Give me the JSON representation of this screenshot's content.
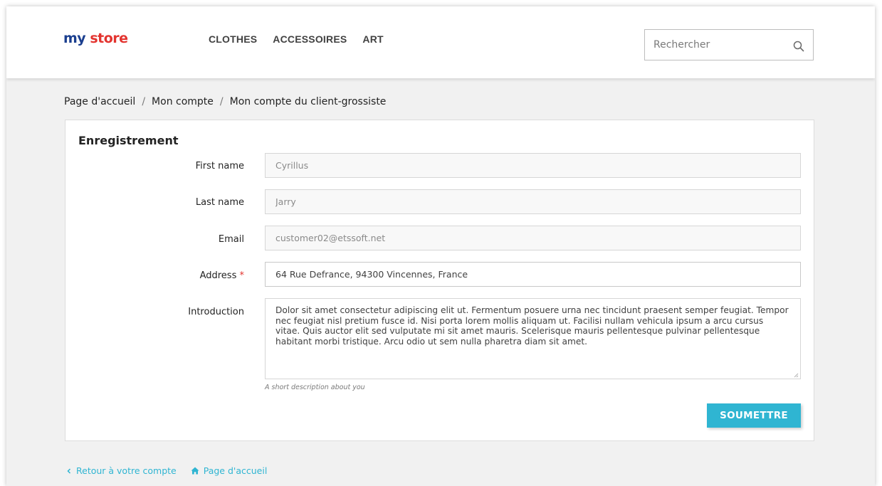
{
  "header": {
    "logo": {
      "word1": "my",
      "word2": "store"
    },
    "nav": [
      "CLOTHES",
      "ACCESSOIRES",
      "ART"
    ],
    "search": {
      "placeholder": "Rechercher",
      "icon": "search-icon"
    }
  },
  "breadcrumb": [
    "Page d'accueil",
    "Mon compte",
    "Mon compte du client-grossiste"
  ],
  "form": {
    "title": "Enregistrement",
    "fields": {
      "first_name": {
        "label": "First name",
        "value": "Cyrillus"
      },
      "last_name": {
        "label": "Last name",
        "value": "Jarry"
      },
      "email": {
        "label": "Email",
        "value": "customer02@etssoft.net"
      },
      "address": {
        "label": "Address",
        "required_mark": "*",
        "value": "64 Rue Defrance, 94300 Vincennes, France"
      },
      "introduction": {
        "label": "Introduction",
        "value": "Dolor sit amet consectetur adipiscing elit ut. Fermentum posuere urna nec tincidunt praesent semper feugiat. Tempor nec feugiat nisl pretium fusce id. Nisi porta lorem mollis aliquam ut. Facilisi nullam vehicula ipsum a arcu cursus vitae. Quis auctor elit sed vulputate mi sit amet mauris. Scelerisque mauris pellentesque pulvinar pellentesque habitant morbi tristique. Arcu odio ut sem nulla pharetra diam sit amet.",
        "hint": "A short description about you"
      }
    },
    "submit_label": "SOUMETTRE"
  },
  "footer": {
    "back_link": "Retour à votre compte",
    "home_link": "Page d'accueil"
  },
  "colors": {
    "accent": "#2fb5d2",
    "logo_blue": "#1b3f8f",
    "logo_red": "#e3342f"
  }
}
